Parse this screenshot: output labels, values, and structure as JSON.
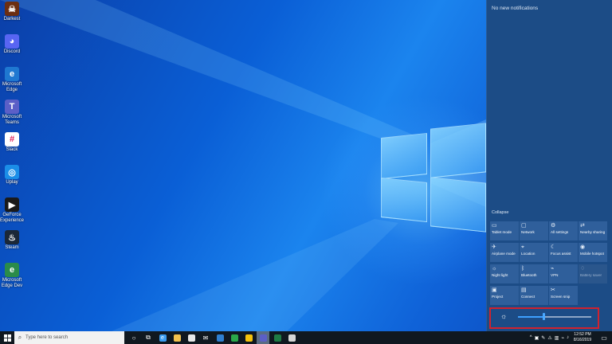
{
  "desktop": {
    "icons": [
      {
        "name": "Darkest",
        "color": "#6b2e12",
        "glyph": "☠"
      },
      {
        "name": "Discord",
        "color": "#5865f2",
        "glyph": "◕"
      },
      {
        "name": "Microsoft Edge",
        "color": "#1f78d1",
        "glyph": "e"
      },
      {
        "name": "Microsoft Teams",
        "color": "#5b5fc7",
        "glyph": "T"
      },
      {
        "name": "Slack",
        "color": "#ffffff",
        "glyph": "#"
      },
      {
        "name": "Uplay",
        "color": "#1b8ee8",
        "glyph": "◎"
      },
      {
        "name": "GeForce Experience",
        "color": "#1a1a1a",
        "glyph": "▶"
      },
      {
        "name": "Steam",
        "color": "#1b2838",
        "glyph": "♨"
      },
      {
        "name": "Microsoft Edge Dev",
        "color": "#2a8b4a",
        "glyph": "e"
      }
    ]
  },
  "action_center": {
    "no_notifications": "No new notifications",
    "collapse_label": "Collapse",
    "tiles": [
      {
        "label": "Tablet mode",
        "icon": "▭",
        "active": true
      },
      {
        "label": "Network",
        "icon": "▢",
        "active": true
      },
      {
        "label": "All settings",
        "icon": "⚙",
        "active": true
      },
      {
        "label": "Nearby sharing",
        "icon": "⇄",
        "active": true
      },
      {
        "label": "Airplane mode",
        "icon": "✈",
        "active": true
      },
      {
        "label": "Location",
        "icon": "⌖",
        "active": true
      },
      {
        "label": "Focus assist",
        "icon": "☾",
        "active": true
      },
      {
        "label": "Mobile hotspot",
        "icon": "◉",
        "active": true
      },
      {
        "label": "Night light",
        "icon": "☼",
        "active": true
      },
      {
        "label": "Bluetooth",
        "icon": "ᛒ",
        "active": true
      },
      {
        "label": "VPN",
        "icon": "⌁",
        "active": true
      },
      {
        "label": "Battery saver",
        "icon": "♢",
        "active": false
      },
      {
        "label": "Project",
        "icon": "▣",
        "active": true
      },
      {
        "label": "Connect",
        "icon": "▤",
        "active": true
      },
      {
        "label": "Screen snip",
        "icon": "✂",
        "active": true
      }
    ],
    "brightness": {
      "level": 0.35,
      "icon": "sun-icon"
    }
  },
  "taskbar": {
    "search_placeholder": "Type here to search",
    "apps": [
      {
        "name": "task-view",
        "glyph": "○",
        "color": "",
        "active": false
      },
      {
        "name": "timeline",
        "glyph": "⧉",
        "color": "",
        "active": false
      },
      {
        "name": "edge",
        "glyph": "e",
        "color": "#3b9cf0",
        "active": false
      },
      {
        "name": "file-explorer",
        "glyph": "",
        "color": "#f2c14e",
        "active": false
      },
      {
        "name": "store",
        "glyph": "",
        "color": "#e8e8e8",
        "active": false
      },
      {
        "name": "mail",
        "glyph": "✉",
        "color": "",
        "active": false
      },
      {
        "name": "photos",
        "glyph": "",
        "color": "#2f7fd0",
        "active": false
      },
      {
        "name": "xbox",
        "glyph": "",
        "color": "#2aa84a",
        "active": false
      },
      {
        "name": "chrome",
        "glyph": "",
        "color": "#f4c20d",
        "active": false
      },
      {
        "name": "teams",
        "glyph": "",
        "color": "#5b5fc7",
        "active": true
      },
      {
        "name": "excel",
        "glyph": "",
        "color": "#1e7b45",
        "active": false
      },
      {
        "name": "paint",
        "glyph": "",
        "color": "#d6d6d6",
        "active": false
      }
    ],
    "tray_icons": [
      "^",
      "▣",
      "✎",
      "⚠",
      "▥",
      "⌁",
      "♪"
    ],
    "time": "12:52 PM",
    "date": "8/16/2019"
  }
}
